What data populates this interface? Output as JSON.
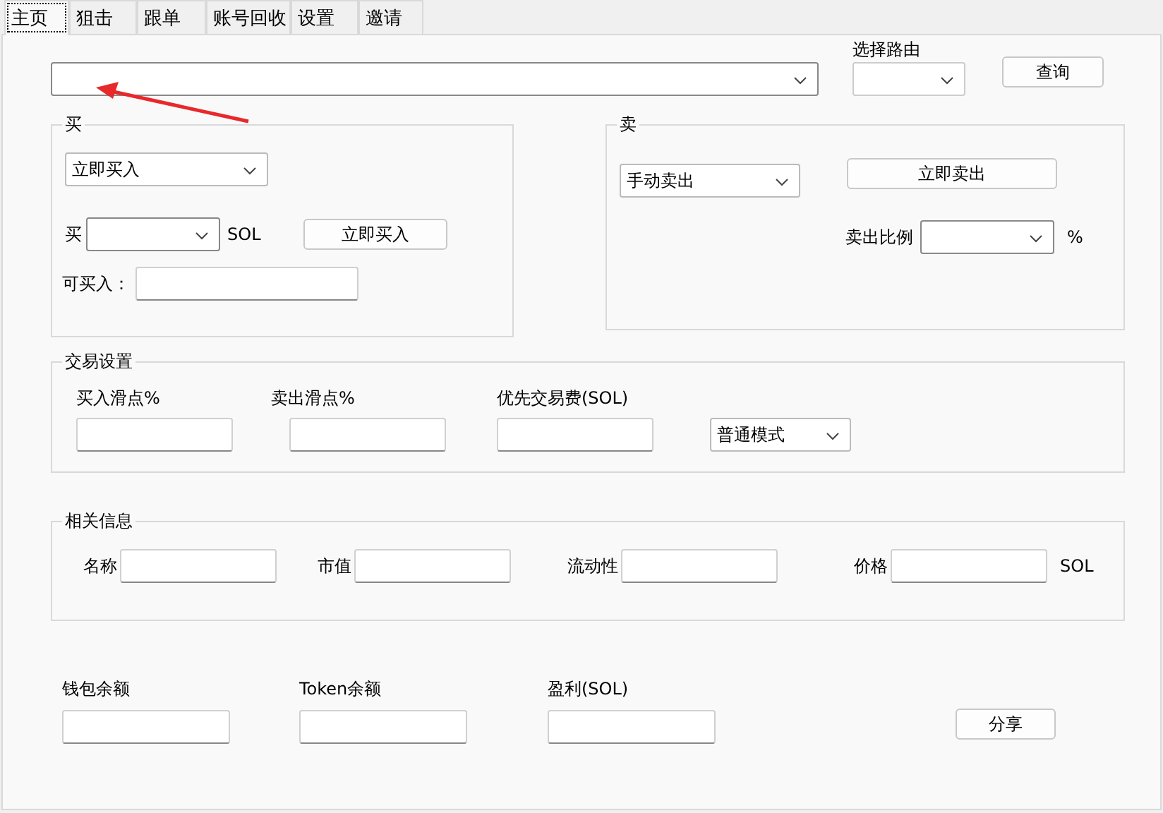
{
  "tabs": [
    {
      "label": "主页",
      "selected": true
    },
    {
      "label": "狙击",
      "selected": false
    },
    {
      "label": "跟单",
      "selected": false
    },
    {
      "label": "账号回收",
      "selected": false
    },
    {
      "label": "设置",
      "selected": false
    },
    {
      "label": "邀请",
      "selected": false
    }
  ],
  "route": {
    "label": "选择路由"
  },
  "query_button": "查询",
  "buy": {
    "title": "买",
    "mode": "立即买入",
    "amount_label": "买",
    "amount_unit": "SOL",
    "buy_button": "立即买入",
    "available_label": "可买入："
  },
  "sell": {
    "title": "卖",
    "mode": "手动卖出",
    "sell_button": "立即卖出",
    "ratio_label": "卖出比例",
    "ratio_unit": "%"
  },
  "trade_settings": {
    "title": "交易设置",
    "fields": [
      "买入滑点%",
      "卖出滑点%",
      "优先交易费(SOL)"
    ],
    "mode": "普通模式"
  },
  "info": {
    "title": "相关信息",
    "fields": [
      {
        "label": "名称"
      },
      {
        "label": "市值"
      },
      {
        "label": "流动性"
      },
      {
        "label": "价格",
        "unit": "SOL"
      }
    ]
  },
  "summary": {
    "fields": [
      "钱包余额",
      "Token余额",
      "盈利(SOL)"
    ],
    "share_button": "分享"
  },
  "annotation": {
    "kind": "arrow"
  }
}
